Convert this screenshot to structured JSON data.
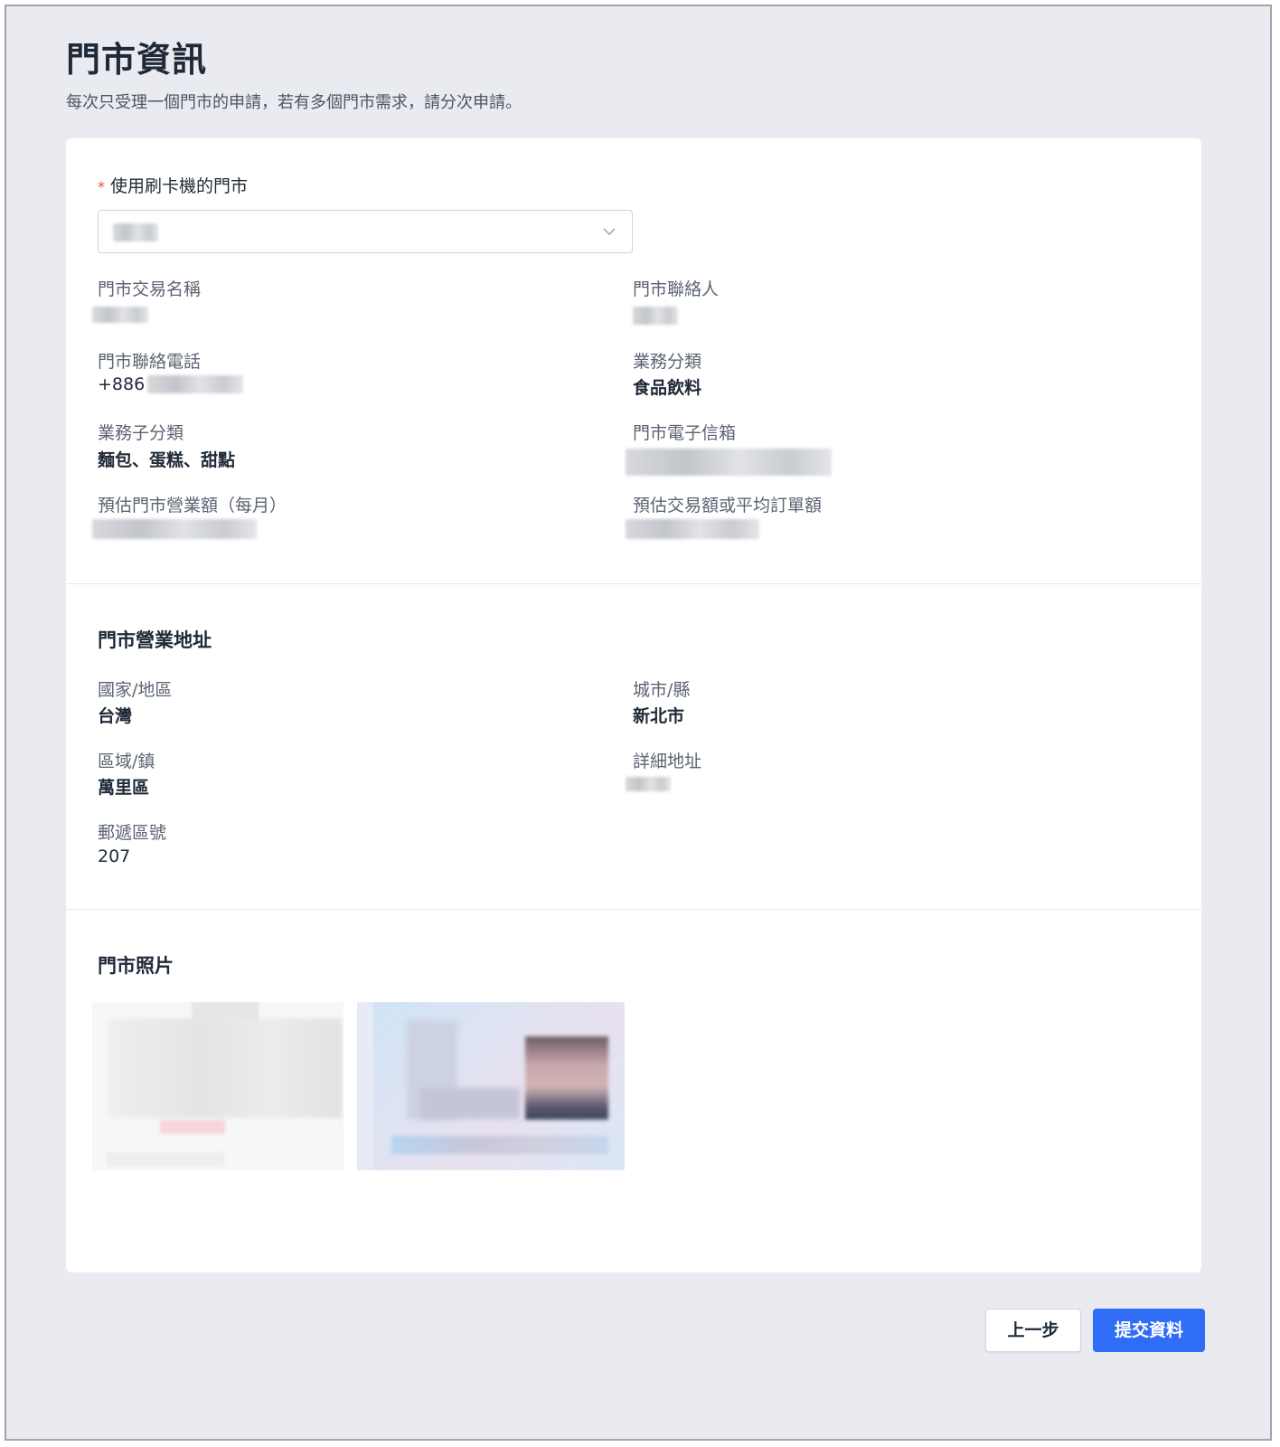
{
  "header": {
    "title": "門市資訊",
    "subtitle": "每次只受理一個門市的申請，若有多個門市需求，請分次申請。"
  },
  "store_select": {
    "required_mark": "*",
    "label": "使用刷卡機的門市"
  },
  "store_info": {
    "trade_name_label": "門市交易名稱",
    "contact_label": "門市聯絡人",
    "phone_label": "門市聯絡電話",
    "phone_prefix": "+886",
    "category_label": "業務分類",
    "category_value": "食品飲料",
    "subcategory_label": "業務子分類",
    "subcategory_value": "麵包、蛋糕、甜點",
    "email_label": "門市電子信箱",
    "monthly_revenue_label": "預估門市營業額（每月）",
    "avg_order_label": "預估交易額或平均訂單額"
  },
  "address": {
    "section_title": "門市營業地址",
    "country_label": "國家/地區",
    "country_value": "台灣",
    "city_label": "城市/縣",
    "city_value": "新北市",
    "district_label": "區域/鎮",
    "district_value": "萬里區",
    "detail_label": "詳細地址",
    "postal_label": "郵遞區號",
    "postal_value": "207"
  },
  "photos": {
    "section_title": "門市照片"
  },
  "footer": {
    "prev_label": "上一步",
    "submit_label": "提交資料"
  },
  "colors": {
    "primary": "#2f6df6",
    "background": "#e9ebf0",
    "required": "#ef4444"
  },
  "icons": {
    "select_arrow": "chevron-down-icon"
  }
}
